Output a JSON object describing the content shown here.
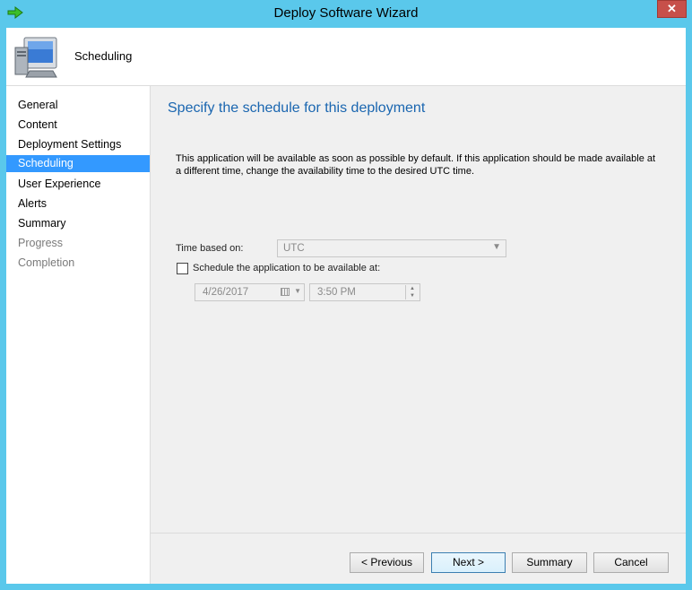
{
  "window": {
    "title": "Deploy Software Wizard",
    "close_label": "✕"
  },
  "header": {
    "title": "Scheduling"
  },
  "nav": {
    "items": [
      {
        "label": "General",
        "state": "normal"
      },
      {
        "label": "Content",
        "state": "normal"
      },
      {
        "label": "Deployment Settings",
        "state": "normal"
      },
      {
        "label": "Scheduling",
        "state": "active"
      },
      {
        "label": "User Experience",
        "state": "normal"
      },
      {
        "label": "Alerts",
        "state": "normal"
      },
      {
        "label": "Summary",
        "state": "normal"
      },
      {
        "label": "Progress",
        "state": "disabled"
      },
      {
        "label": "Completion",
        "state": "disabled"
      }
    ]
  },
  "main": {
    "heading": "Specify the schedule for this deployment",
    "description": "This application will be available as soon as possible by default. If this application should be made available at a different time, change the availability time to the desired UTC time.",
    "time_based_label": "Time based on:",
    "time_based_value": "UTC",
    "schedule_checkbox_label": "Schedule the application to be available at:",
    "schedule_checked": false,
    "date_value": "4/26/2017",
    "time_value": "3:50 PM"
  },
  "buttons": {
    "previous": "< Previous",
    "next": "Next >",
    "summary": "Summary",
    "cancel": "Cancel"
  },
  "colors": {
    "titlebar": "#5ac8eb",
    "accent": "#3399ff",
    "heading": "#1a66b0",
    "close": "#c7504a"
  },
  "icons": {
    "title": "green-arrow-icon",
    "header": "computer-icon"
  }
}
